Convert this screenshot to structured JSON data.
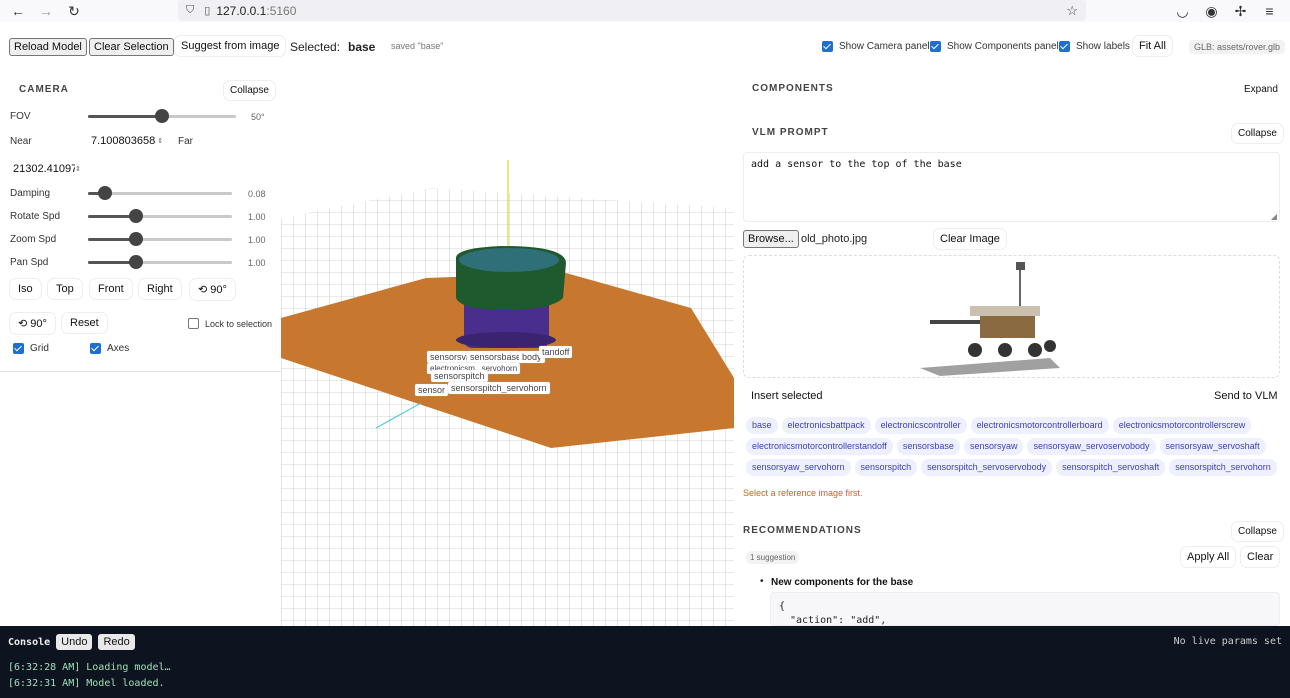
{
  "browser": {
    "url_host": "127.0.0.1",
    "url_port": ":5160"
  },
  "toolbar": {
    "reload_label": "Reload Model",
    "clear_selection_label": "Clear Selection",
    "suggest_label": "Suggest from image",
    "selected_prefix": "Selected:",
    "selected_value": "base",
    "saved_status": "saved \"base\"",
    "show_camera_label": "Show Camera panel",
    "show_components_label": "Show Components panel",
    "show_labels_label": "Show labels",
    "fit_all_label": "Fit All",
    "glb_label": "GLB: assets/rover.glb"
  },
  "camera": {
    "title": "CAMERA",
    "collapse_label": "Collapse",
    "fov_label": "FOV",
    "fov_value": "50°",
    "fov_level": 0.5,
    "near_label": "Near",
    "near_value": "7.100803658",
    "far_label": "Far",
    "far_value": "21302.41097",
    "damping_label": "Damping",
    "damping_value": "0.08",
    "damping_level": 0.12,
    "rotate_label": "Rotate Spd",
    "rotate_value": "1.00",
    "rotate_level": 0.33,
    "zoom_label": "Zoom Spd",
    "zoom_value": "1.00",
    "zoom_level": 0.33,
    "pan_label": "Pan Spd",
    "pan_value": "1.00",
    "pan_level": 0.33,
    "views": [
      "Iso",
      "Top",
      "Front",
      "Right",
      "⟲ 90°"
    ],
    "rot_ccw_label": "⟲ 90°",
    "reset_label": "Reset",
    "lock_label": "Lock to selection",
    "grid_label": "Grid",
    "axes_label": "Axes"
  },
  "viewport": {
    "labels": [
      "sensorsva",
      "sensorsbase",
      "body",
      "tandoff",
      "electronicsm...servohorn",
      "sensorspitch",
      "sensor",
      "sensorspitch_servohorn"
    ]
  },
  "components": {
    "title": "COMPONENTS",
    "expand_label": "Expand",
    "vlm_title": "VLM PROMPT",
    "vlm_collapse": "Collapse",
    "prompt_text": "add a sensor to the top of the base",
    "browse_label": "Browse...",
    "file_name": "old_photo.jpg",
    "clear_image_label": "Clear Image",
    "insert_label": "Insert selected",
    "send_label": "Send to VLM",
    "chips": [
      "base",
      "electronicsbattpack",
      "electronicscontroller",
      "electronicsmotorcontrollerboard",
      "electronicsmotorcontrollerscrew",
      "electronicsmotorcontrollerstandoff",
      "sensorsbase",
      "sensorsyaw",
      "sensorsyaw_servoservobody",
      "sensorsyaw_servoshaft",
      "sensorsyaw_servohorn",
      "sensorspitch",
      "sensorspitch_servoservobody",
      "sensorspitch_servoshaft",
      "sensorspitch_servohorn"
    ],
    "warning": "Select a reference image first.",
    "recs_title": "RECOMMENDATIONS",
    "recs_collapse": "Collapse",
    "suggestion_count": "1 suggestion",
    "apply_all_label": "Apply All",
    "clear_label": "Clear",
    "rec_item": "New components for the base",
    "code_line1": "{",
    "code_line2": "\"action\": \"add\","
  },
  "console": {
    "title": "Console",
    "undo_label": "Undo",
    "redo_label": "Redo",
    "status": "No live params set",
    "log1": "[6:32:28 AM] Loading model…",
    "log2": "[6:32:31 AM] Model loaded."
  },
  "colors": {
    "accent": "#1f6fd0",
    "chip_text": "#3b3fb6",
    "warning": "#c06a10",
    "ground": "#c7782e",
    "console_bg": "#0d1420"
  }
}
